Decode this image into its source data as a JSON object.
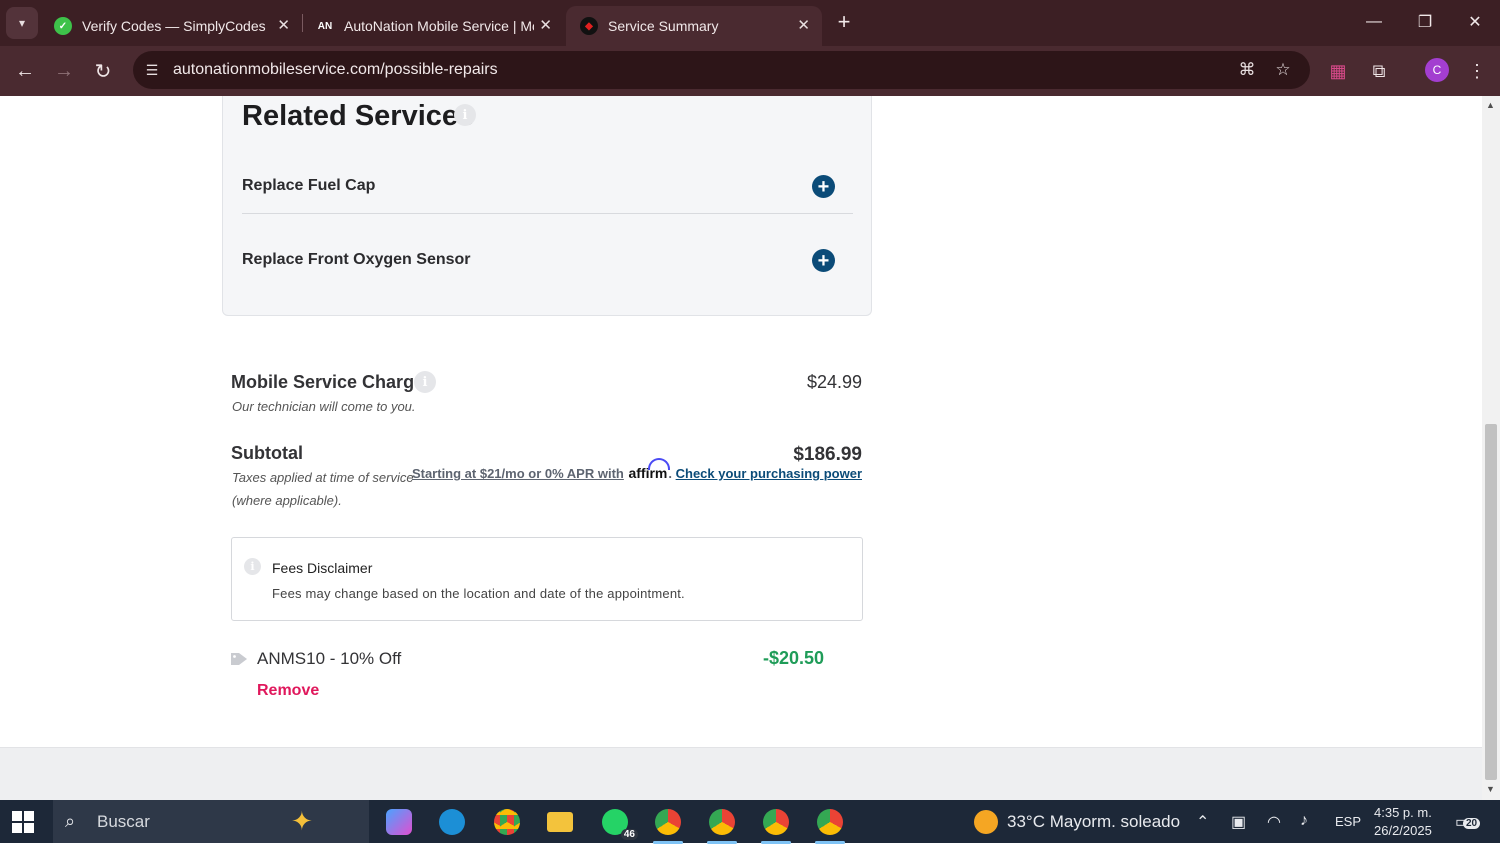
{
  "browser": {
    "tabs": [
      {
        "title": "Verify Codes — SimplyCodes",
        "favicon": "simplycodes-icon",
        "active": false
      },
      {
        "title": "AutoNation Mobile Service | Mo",
        "favicon": "autonation-icon",
        "active": false
      },
      {
        "title": "Service Summary",
        "favicon": "autonation-red-icon",
        "active": true
      }
    ],
    "url": "autonationmobileservice.com/possible-repairs",
    "profile_initial": "C"
  },
  "page": {
    "related": {
      "title": "Related Services",
      "items": [
        {
          "label": "Replace Fuel Cap"
        },
        {
          "label": "Replace Front Oxygen Sensor"
        }
      ]
    },
    "mobile_charge": {
      "title": "Mobile Service Charge",
      "subtitle": "Our technician will come to you.",
      "price": "$24.99"
    },
    "subtotal": {
      "title": "Subtotal",
      "note": "Taxes applied at time of service (where applicable).",
      "price": "$186.99",
      "affirm_prefix": "Starting at $21/mo or 0% APR with",
      "affirm_brand": "affirm",
      "affirm_link": "Check your purchasing power"
    },
    "fees": {
      "title": "Fees Disclaimer",
      "text": "Fees may change based on the location and date of the appointment."
    },
    "promo": {
      "code": "ANMS10 - 10% Off",
      "amount": "-$20.50",
      "remove_label": "Remove"
    }
  },
  "taskbar": {
    "search_placeholder": "Buscar",
    "whatsapp_badge": "46",
    "weather": "33°C  Mayorm. soleado",
    "language": "ESP",
    "time": "4:35 p. m.",
    "date": "26/2/2025",
    "notifications": "20"
  },
  "colors": {
    "brand_blue": "#0b4b78",
    "discount_green": "#1f9c58",
    "remove_pink": "#e0185c",
    "chrome_bg": "#3c1f24"
  }
}
